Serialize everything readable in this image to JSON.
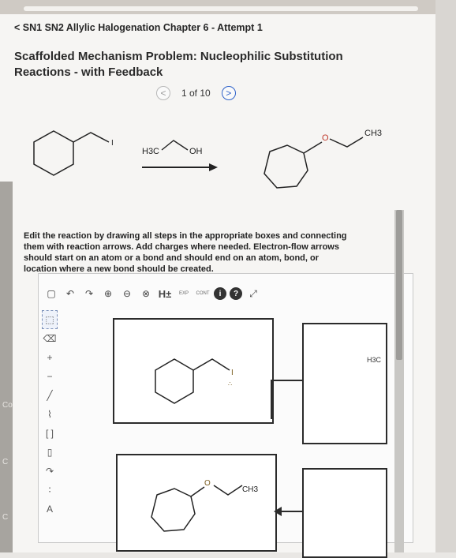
{
  "header": {
    "breadcrumb": "SN1 SN2 Allylic Halogenation Chapter 6 - Attempt 1",
    "title": "Scaffolded Mechanism Problem: Nucleophilic Substitution Reactions - with Feedback"
  },
  "pager": {
    "prev": "<",
    "page_label": "1 of 10",
    "next": ">"
  },
  "reaction": {
    "reactant_label": "I",
    "reagent_left": "H3C",
    "reagent_right": "OH",
    "product_o": "O",
    "product_ch3": "CH3"
  },
  "instructions": "Edit the reaction by drawing all steps in the appropriate boxes and connecting them with reaction arrows. Add charges where needed. Electron-flow arrows should start on an atom or a bond and should end on an atom, bond, or location where a new bond should be created.",
  "toolbar": {
    "h_label": "H±",
    "exp_label": "EXP",
    "cont_label": "CONT",
    "info_label": "i",
    "help_label": "?"
  },
  "sidebar": {
    "plus_label": "+",
    "minus_label": "−",
    "a_label": "A"
  },
  "canvas": {
    "box1_label": "I",
    "box2_label": "H3C",
    "box3_o": "O",
    "box3_ch3": "CH3"
  },
  "side_labels": {
    "co": "Co",
    "c1": "C",
    "c2": "C"
  }
}
